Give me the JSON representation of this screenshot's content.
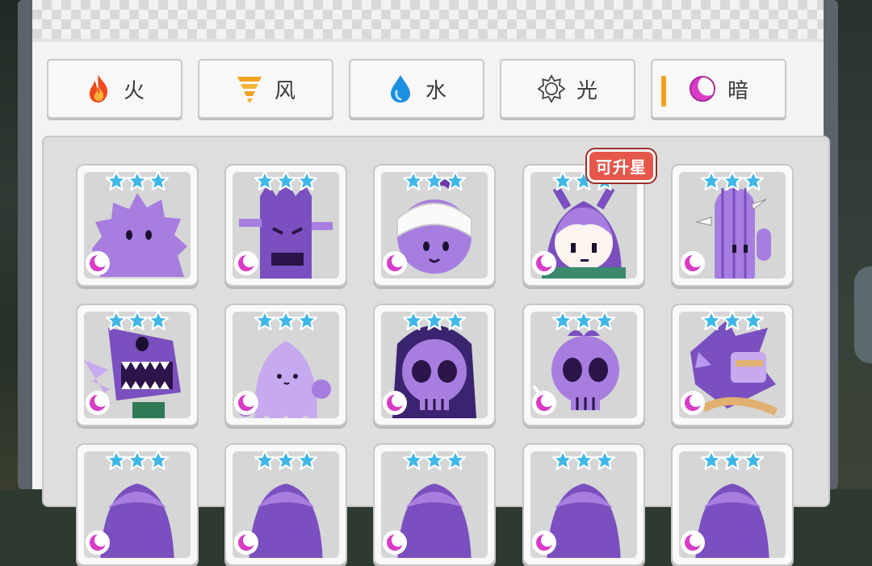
{
  "tabs": [
    {
      "label": "火",
      "icon": "fire-icon",
      "active": false,
      "color": "#f04a1c"
    },
    {
      "label": "风",
      "icon": "tornado-icon",
      "active": false,
      "color": "#f0a220"
    },
    {
      "label": "水",
      "icon": "water-drop-icon",
      "active": false,
      "color": "#1d8fe0"
    },
    {
      "label": "光",
      "icon": "sun-icon",
      "active": false,
      "color": "#ffffff"
    },
    {
      "label": "暗",
      "icon": "crescent-moon-icon",
      "active": true,
      "color": "#d83cc6"
    }
  ],
  "accent_color": "#f4a21d",
  "cards": [
    {
      "stars": 3,
      "element": "dark",
      "character": "purple-spiky-blob"
    },
    {
      "stars": 3,
      "element": "dark",
      "character": "purple-tree-stump"
    },
    {
      "stars": 3,
      "element": "dark",
      "character": "bandaged-mummy-plant"
    },
    {
      "stars": 3,
      "element": "dark",
      "character": "purple-hair-girl",
      "badge": "可升星"
    },
    {
      "stars": 3,
      "element": "dark",
      "character": "purple-cactus"
    },
    {
      "stars": 3,
      "element": "dark",
      "character": "chomper-plant"
    },
    {
      "stars": 3,
      "element": "dark",
      "character": "purple-ghost"
    },
    {
      "stars": 3,
      "element": "dark",
      "character": "skull-hooded"
    },
    {
      "stars": 3,
      "element": "dark",
      "character": "skull-archer"
    },
    {
      "stars": 3,
      "element": "dark",
      "character": "purple-knight"
    },
    {
      "stars": 3,
      "element": "dark",
      "character": "purple-plant-a"
    },
    {
      "stars": 3,
      "element": "dark",
      "character": "purple-plant-b"
    },
    {
      "stars": 3,
      "element": "dark",
      "character": "purple-plant-c"
    },
    {
      "stars": 3,
      "element": "dark",
      "character": "purple-plant-d"
    },
    {
      "stars": 3,
      "element": "dark",
      "character": "purple-plant-e"
    }
  ]
}
